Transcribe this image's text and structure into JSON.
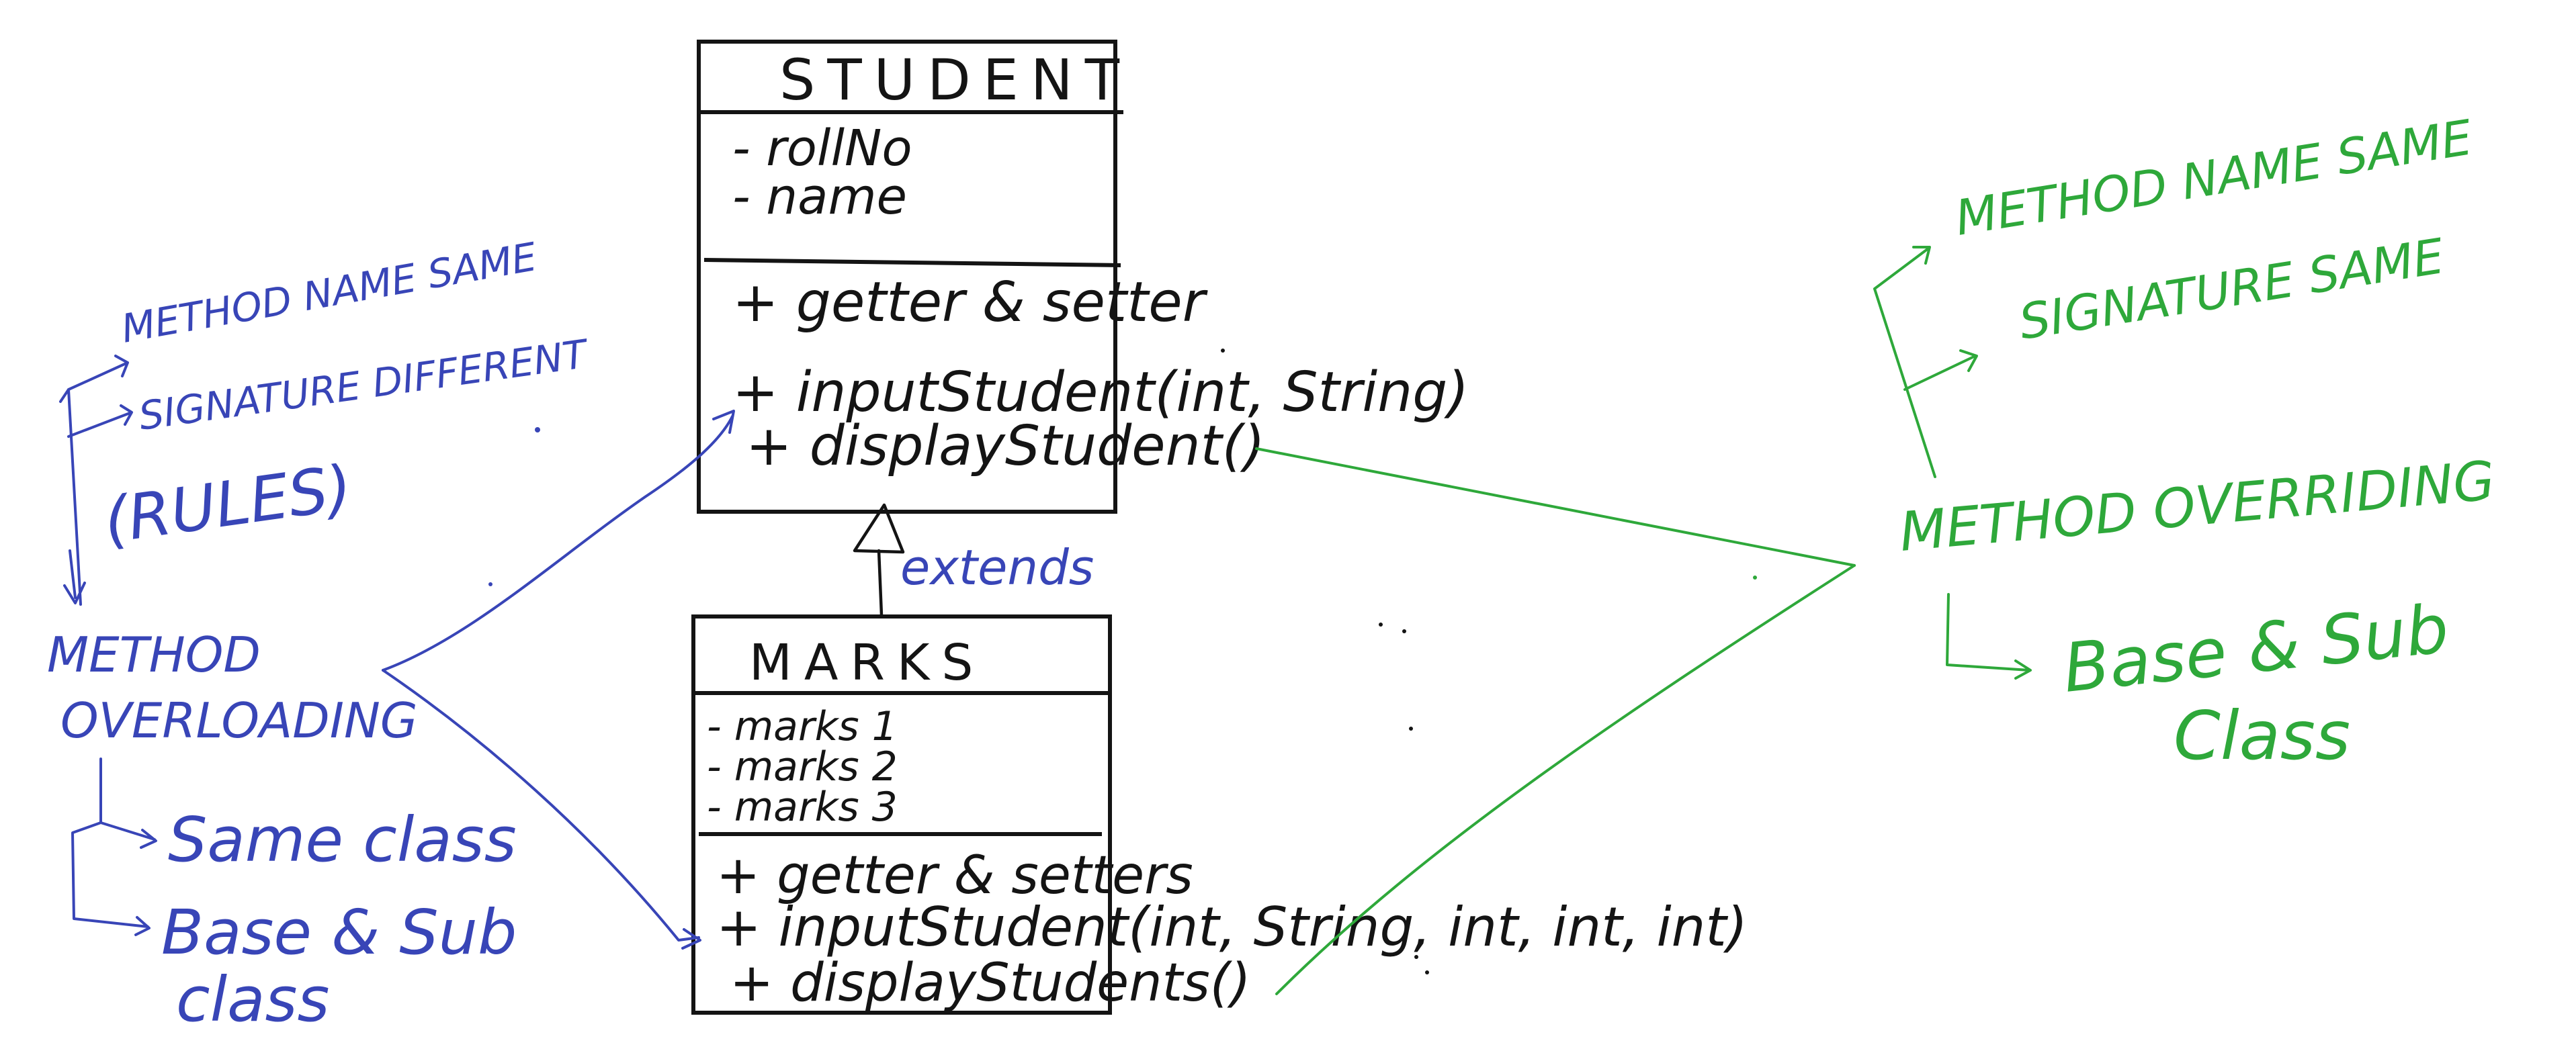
{
  "colors": {
    "black_ink": "#141414",
    "blue_ink": "#3845b7",
    "green_ink": "#2ea83a"
  },
  "student": {
    "title": "STUDENT",
    "attributes": [
      "- rollNo",
      "- name"
    ],
    "methods": [
      "+ getter & setter",
      "+ inputStudent(int, String)",
      "+ displayStudent()"
    ]
  },
  "inheritance_label": "extends",
  "marks": {
    "title": "MARKS",
    "attributes": [
      "- marks 1",
      "- marks 2",
      "- marks 3"
    ],
    "methods": [
      "+ getter & setters",
      "+ inputStudent(int, String, int, int, int)",
      "+ displayStudents()"
    ]
  },
  "overloading": {
    "rules": [
      "METHOD NAME SAME",
      "SIGNATURE DIFFERENT"
    ],
    "rules_label": "(RULES)",
    "title_line1": "METHOD",
    "title_line2": "OVERLOADING",
    "scope": [
      "Same class",
      "Base & Sub"
    ],
    "scope_cont": "class"
  },
  "overriding": {
    "rules": [
      "METHOD NAME SAME",
      "SIGNATURE SAME"
    ],
    "title": "METHOD OVERRIDING",
    "scope_line1": "Base & Sub",
    "scope_line2": "Class"
  }
}
